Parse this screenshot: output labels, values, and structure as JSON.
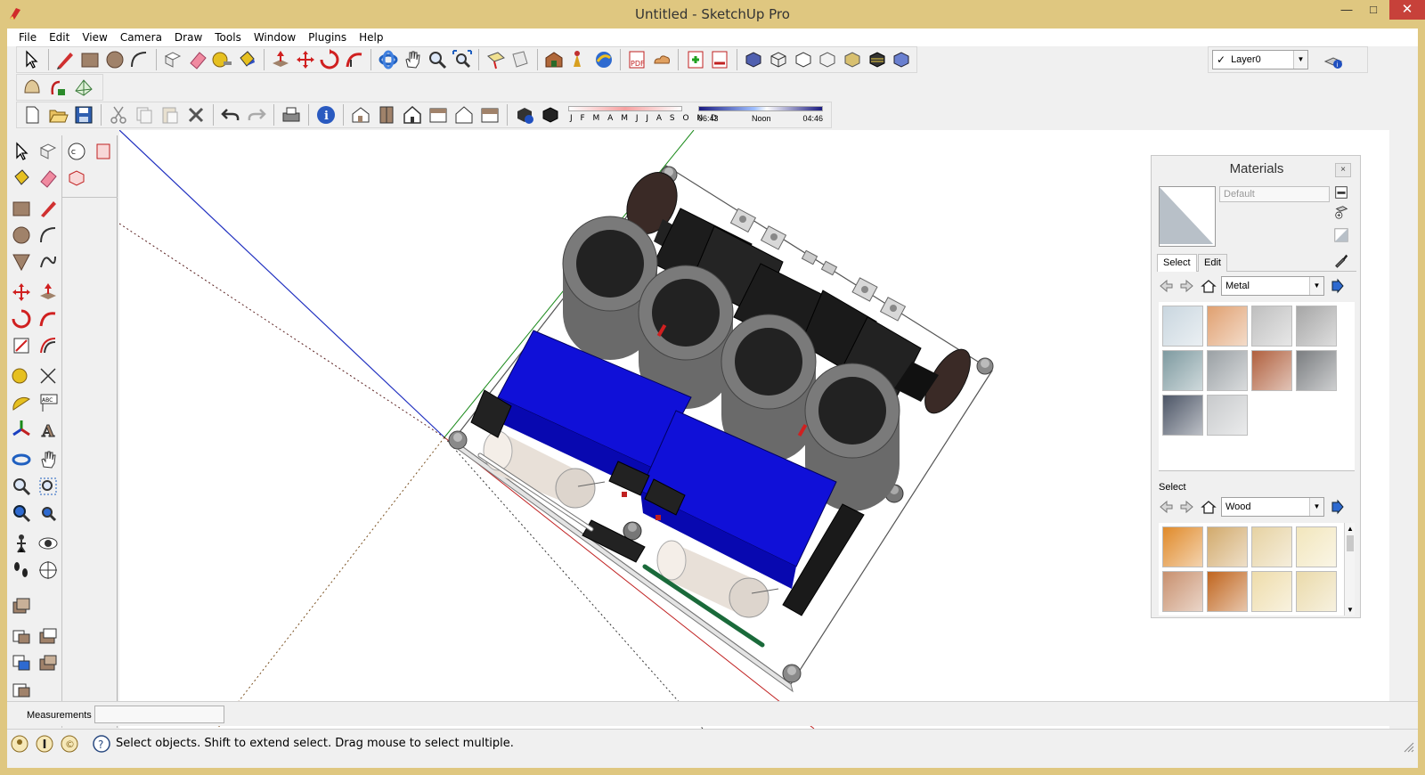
{
  "window": {
    "title": "Untitled - SketchUp Pro",
    "minimize_glyph": "—",
    "maximize_glyph": "□",
    "close_glyph": "✕"
  },
  "menu": [
    "File",
    "Edit",
    "View",
    "Camera",
    "Draw",
    "Tools",
    "Window",
    "Plugins",
    "Help"
  ],
  "layers": {
    "current": "Layer0"
  },
  "shadows": {
    "months": "J F M A M J J A S O N D",
    "time_start": "06:43",
    "time_mid": "Noon",
    "time_end": "04:46"
  },
  "materials_panel": {
    "title": "Materials",
    "close_glyph": "×",
    "material_name_placeholder": "Default",
    "tab_select": "Select",
    "tab_edit": "Edit",
    "library_top": "Metal",
    "secondary_label": "Select",
    "library_bottom": "Wood",
    "metal_swatches": [
      "#c9d6df",
      "#e0a070",
      "#bfbfbf",
      "#a6a6a6",
      "#7e9aa0",
      "#9aa0a4",
      "#b0603e",
      "#7a7d80",
      "#4c5566",
      "#c8cacc"
    ],
    "wood_swatches": [
      "#e08a2a",
      "#d2aa6c",
      "#e6d2a2",
      "#f2e6bc",
      "#c8906e",
      "#c0651e",
      "#eedcaa",
      "#eadaaa"
    ]
  },
  "measurements": {
    "label": "Measurements",
    "value": ""
  },
  "status": {
    "text": "Select objects. Shift to extend select. Drag mouse to select multiple."
  },
  "icons": [
    "select-icon",
    "pencil-icon",
    "rectangle-icon",
    "circle-icon",
    "arc-icon",
    "eraser-icon",
    "paint-bucket-icon",
    "tape-measure-icon",
    "push-pull-icon",
    "move-icon",
    "rotate-icon",
    "follow-me-icon",
    "orbit-icon",
    "pan-icon",
    "zoom-icon",
    "zoom-extents-icon",
    "pdf-icon",
    "info-icon",
    "undo-icon",
    "redo-icon",
    "print-icon",
    "save-icon",
    "open-icon",
    "new-icon"
  ]
}
